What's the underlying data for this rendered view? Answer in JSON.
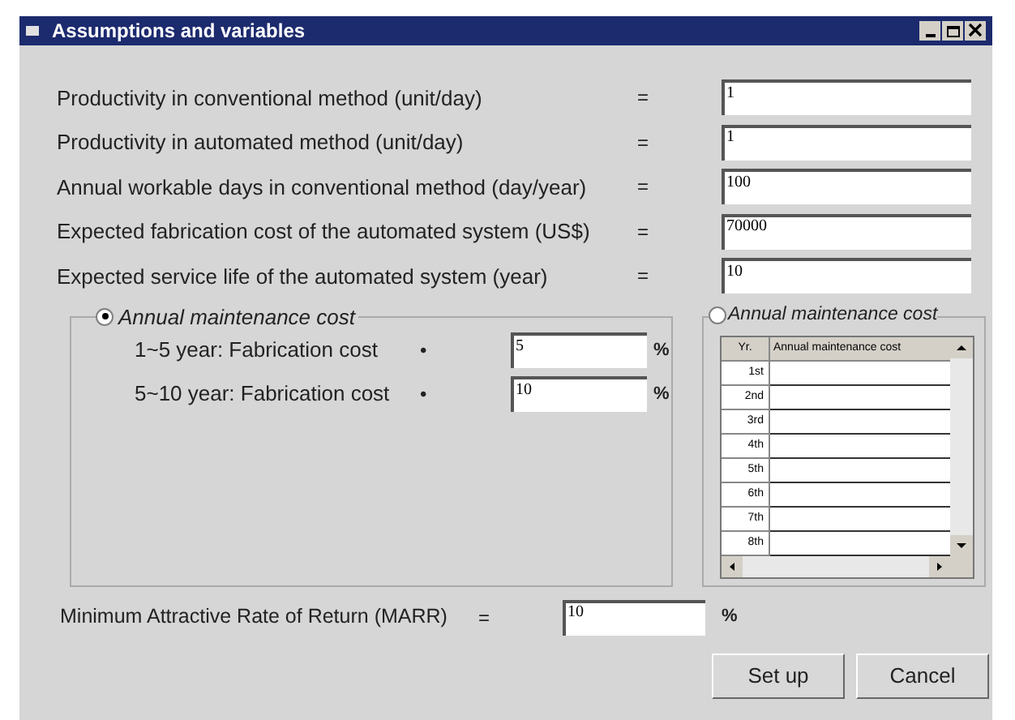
{
  "window": {
    "title": "Assumptions and variables"
  },
  "variables": [
    {
      "label": "Productivity in conventional method (unit/day)",
      "sign": "=",
      "value": "1"
    },
    {
      "label": "Productivity in automated method (unit/day)",
      "sign": "=",
      "value": "1"
    },
    {
      "label": "Annual workable days  in conventional method (day/year)",
      "sign": "=",
      "value": "100"
    },
    {
      "label": "Expected fabrication cost of  the automated system (US$)",
      "sign": "=",
      "value": "70000"
    },
    {
      "label": "Expected service life of the automated system (year)",
      "sign": "=",
      "value": "10"
    }
  ],
  "maintenance_simple": {
    "label": "Annual maintenance cost",
    "selected": true,
    "rows": [
      {
        "label": "1~5 year: Fabrication cost",
        "sign": "•",
        "value": "5",
        "unit": "%"
      },
      {
        "label": "5~10 year: Fabrication cost",
        "sign": "•",
        "value": "10",
        "unit": "%"
      }
    ]
  },
  "maintenance_table": {
    "label": "Annual maintenance cost",
    "selected": false,
    "columns": [
      "Yr.",
      "Annual maintenance cost"
    ],
    "rows": [
      "1st",
      "2nd",
      "3rd",
      "4th",
      "5th",
      "6th",
      "7th",
      "8th"
    ]
  },
  "marr": {
    "label": "Minimum Attractive Rate of Return (MARR)",
    "sign": "=",
    "value": "10",
    "unit": "%"
  },
  "buttons": [
    "Set up",
    "Cancel"
  ]
}
